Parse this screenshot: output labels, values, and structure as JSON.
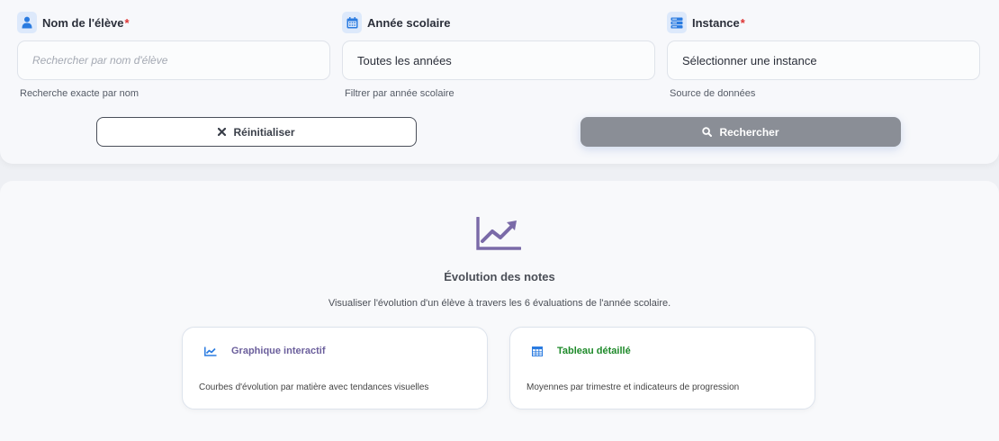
{
  "filters": {
    "student": {
      "label": "Nom de l'élève",
      "required_mark": "*",
      "placeholder": "Rechercher par nom d'élève",
      "value": "",
      "help": "Recherche exacte par nom",
      "icon": "user-icon"
    },
    "year": {
      "label": "Année scolaire",
      "value": "Toutes les années",
      "help": "Filtrer par année scolaire",
      "icon": "calendar-icon"
    },
    "instance": {
      "label": "Instance",
      "required_mark": "*",
      "value": "Sélectionner une instance",
      "help": "Source de données",
      "icon": "server-icon"
    }
  },
  "actions": {
    "reset_label": "Réinitialiser",
    "search_label": "Rechercher"
  },
  "hero": {
    "icon": "chart-line-icon",
    "title": "Évolution des notes",
    "description": "Visualiser l'évolution d'un élève à travers les 6 évaluations de l'année scolaire."
  },
  "features": [
    {
      "title": "Graphique interactif",
      "description": "Courbes d'évolution par matière avec tendances visuelles",
      "icon": "chart-line-icon",
      "color": "#6b5f9c"
    },
    {
      "title": "Tableau détaillé",
      "description": "Moyennes par trimestre et indicateurs de progression",
      "icon": "table-icon",
      "color": "#1e8a2a"
    }
  ],
  "colors": {
    "label_icon_bg": "#dde9fb",
    "label_icon_fg": "#2a7be0",
    "required": "#d33333",
    "search_button": "#8a8e96",
    "hero_icon": "#7a6aa8"
  }
}
